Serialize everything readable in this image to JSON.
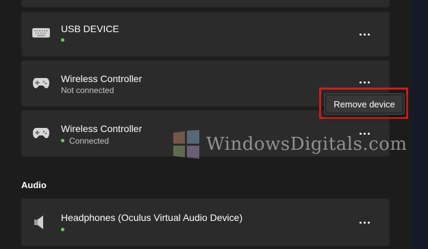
{
  "devices": [
    {
      "name": "USB DEVICE",
      "icon": "keyboard-icon",
      "status": "",
      "connected": true
    },
    {
      "name": "Wireless Controller",
      "icon": "gamepad-icon",
      "status": "Not connected",
      "connected": false
    },
    {
      "name": "Wireless Controller",
      "icon": "gamepad-icon",
      "status": "Connected",
      "connected": true
    }
  ],
  "audio": {
    "heading": "Audio",
    "devices": [
      {
        "name": "Headphones (Oculus Virtual Audio Device)",
        "icon": "speaker-icon",
        "status": "",
        "connected": true
      }
    ]
  },
  "context_menu": {
    "items": [
      {
        "label": "Remove device"
      }
    ]
  },
  "watermark": {
    "text": "WindowsDigitals.com"
  },
  "colors": {
    "background": "#1c1c1c",
    "card": "#2b2b2b",
    "status_green": "#6ccb5f",
    "highlight_red": "#cc1f1f",
    "menu_bg": "#2c2c2c"
  }
}
